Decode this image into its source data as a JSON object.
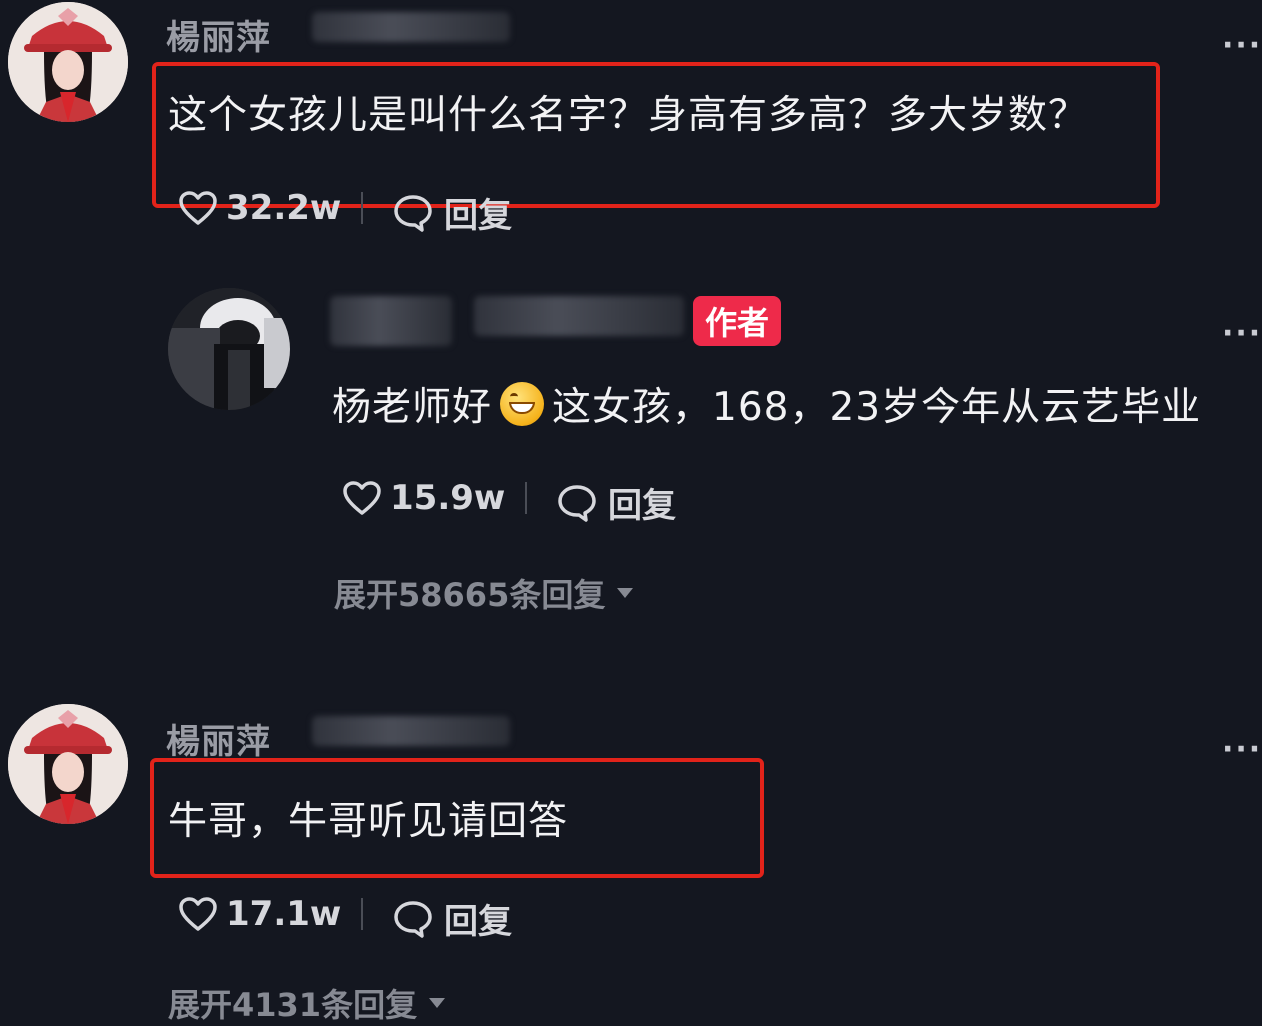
{
  "comments": [
    {
      "username": "楊丽萍",
      "text": "这个女孩儿是叫什么名字？身高有多高？多大岁数？",
      "likes": "32.2w",
      "reply_label": "回复",
      "more": "···"
    },
    {
      "badge": "作者",
      "text_before_emoji": "杨老师好",
      "text_after_emoji": "这女孩，168，23岁今年从云艺毕业",
      "likes": "15.9w",
      "reply_label": "回复",
      "expand": "展开58665条回复",
      "more": "···"
    },
    {
      "username": "楊丽萍",
      "text": "牛哥，牛哥听见请回答",
      "likes": "17.1w",
      "reply_label": "回复",
      "expand": "展开4131条回复",
      "more": "···"
    }
  ],
  "icons": {
    "like": "heart-outline-icon",
    "reply": "speech-bubble-icon",
    "expand": "triangle-down-icon"
  },
  "colors": {
    "background": "#141720",
    "highlight_box": "#e2231a",
    "author_badge": "#ee2a4a"
  }
}
